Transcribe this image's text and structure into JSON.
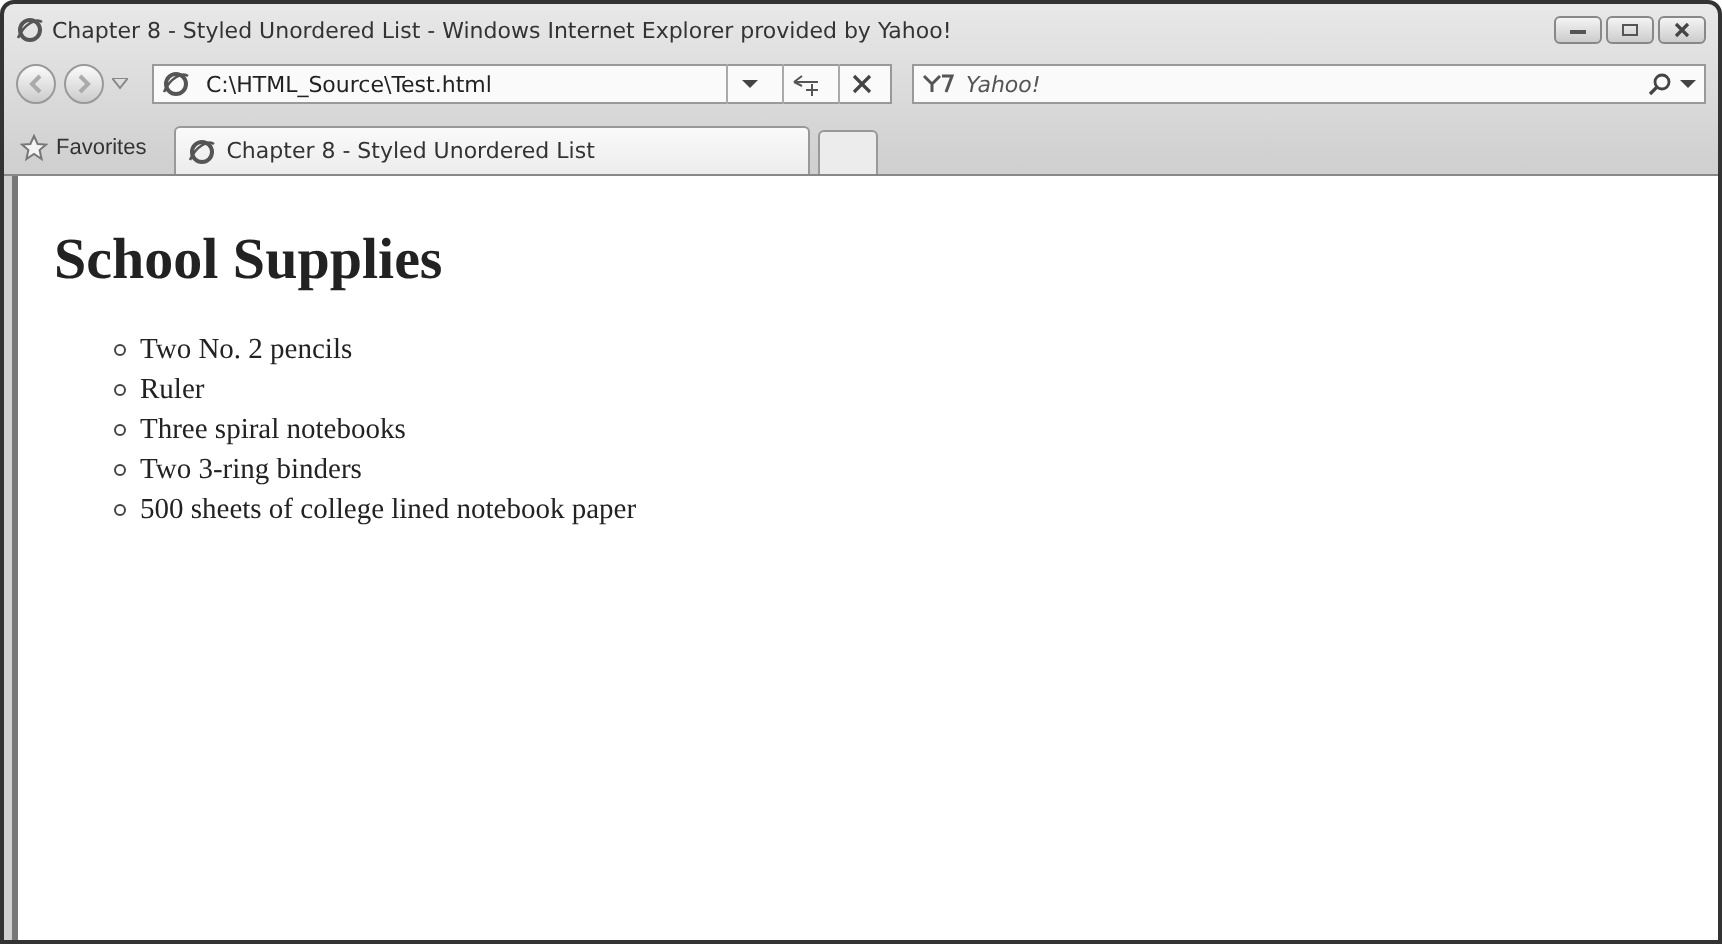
{
  "window": {
    "title": "Chapter 8 - Styled Unordered List - Windows Internet Explorer provided by Yahoo!"
  },
  "address_bar": {
    "value": "C:\\HTML_Source\\Test.html"
  },
  "search": {
    "placeholder": "Yahoo!"
  },
  "favorites": {
    "label": "Favorites"
  },
  "tabs": [
    {
      "label": "Chapter 8 - Styled Unordered List",
      "selected": true
    }
  ],
  "page": {
    "heading": "School Supplies",
    "items": [
      "Two No. 2 pencils",
      "Ruler",
      "Three spiral notebooks",
      "Two 3-ring binders",
      "500 sheets of college lined notebook paper"
    ]
  }
}
